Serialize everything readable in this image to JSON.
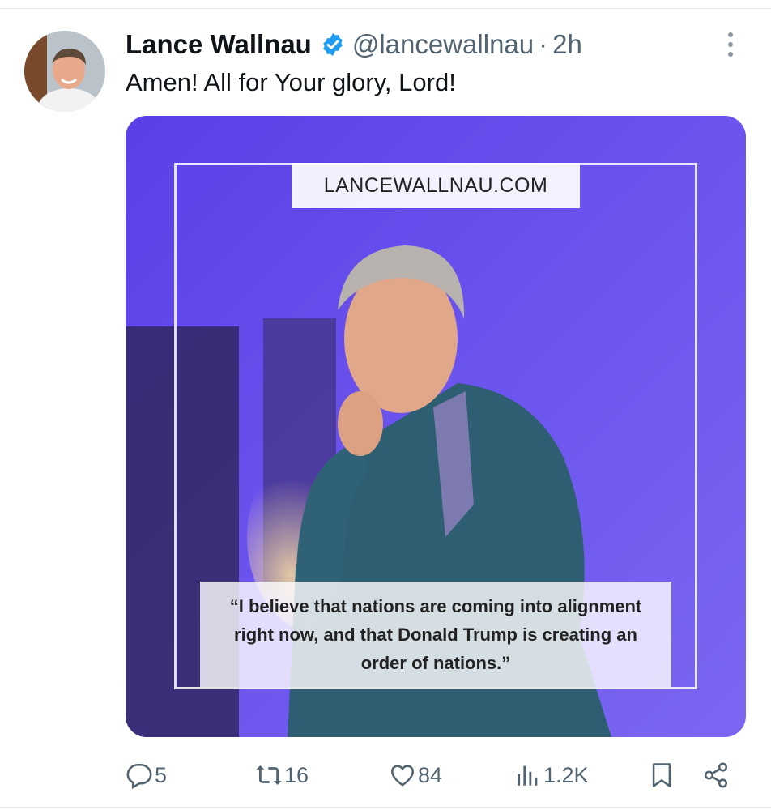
{
  "tweet": {
    "author_name": "Lance Wallnau",
    "handle": "@lancewallnau",
    "separator": "·",
    "time": "2h",
    "text": "Amen! All for Your glory, Lord!"
  },
  "media": {
    "site_label": "LANCEWALLNAU.COM",
    "quote": "“I believe that nations are coming into alignment right now, and that Donald Trump is creating an order of nations.”"
  },
  "actions": {
    "replies": "5",
    "reposts": "16",
    "likes": "84",
    "views": "1.2K"
  },
  "colors": {
    "verified": "#1d9bf0",
    "muted": "#536471",
    "media_bg": "#6a52ee"
  },
  "icons": {
    "more": "more-vertical-icon",
    "reply": "reply-icon",
    "repost": "repost-icon",
    "like": "heart-icon",
    "views": "views-icon",
    "bookmark": "bookmark-icon",
    "share": "share-icon"
  }
}
